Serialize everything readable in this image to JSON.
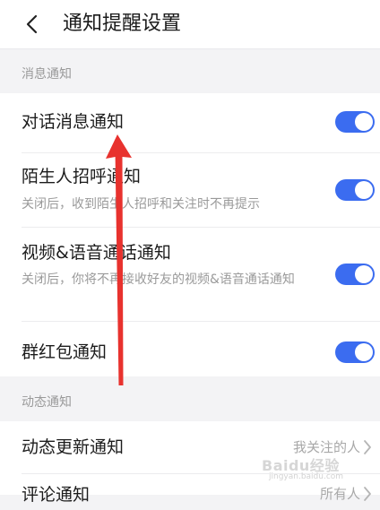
{
  "header": {
    "title": "通知提醒设置",
    "back_icon": "chevron-left-icon"
  },
  "sections": {
    "message": {
      "label": "消息通知",
      "items": [
        {
          "title": "对话消息通知",
          "enabled": true
        },
        {
          "title": "陌生人招呼通知",
          "desc": "关闭后，收到陌生人招呼和关注时不再提示",
          "enabled": true
        },
        {
          "title": "视频&语音通话通知",
          "desc": "关闭后，你将不再接收好友的视频&语音通话通知",
          "enabled": true
        },
        {
          "title": "群红包通知",
          "enabled": true
        }
      ]
    },
    "feed": {
      "label": "动态通知",
      "items": [
        {
          "title": "动态更新通知",
          "value": "我关注的人"
        },
        {
          "title": "评论通知",
          "value": "所有人"
        }
      ]
    }
  },
  "watermark": {
    "text": "Baidu经验",
    "sub": "jingyan.baidu.com"
  },
  "colors": {
    "toggle_on": "#3b6cf0",
    "annotation_arrow": "#e8322e"
  }
}
